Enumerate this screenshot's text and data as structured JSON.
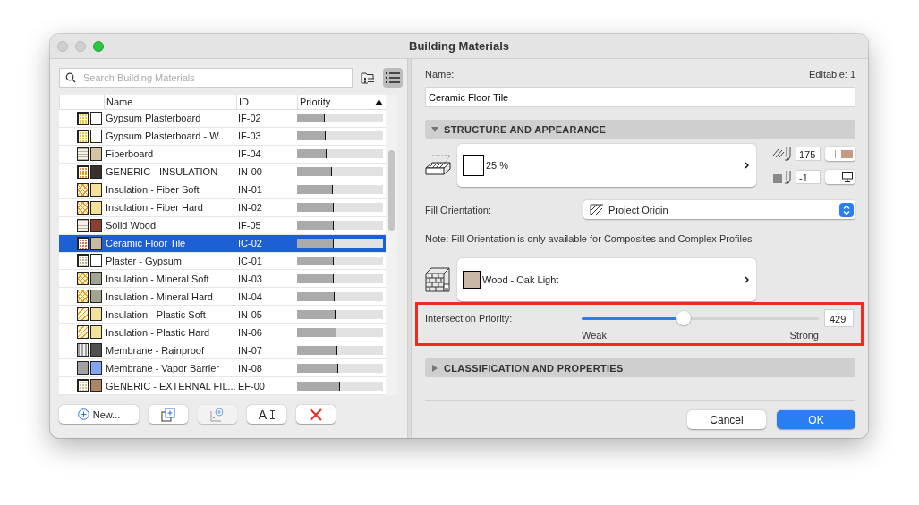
{
  "window": {
    "title": "Building Materials"
  },
  "search": {
    "placeholder": "Search Building Materials"
  },
  "view_toggles": [
    {
      "kind": "tree",
      "selected": false
    },
    {
      "kind": "list",
      "selected": true
    }
  ],
  "table": {
    "columns": [
      "Name",
      "ID",
      "Priority"
    ],
    "sort_ascending": true,
    "rows": [
      {
        "name": "Gypsum Plasterboard",
        "id": "IF-02",
        "level": 0.32,
        "swatches": [
          {
            "kind": "dots",
            "color": "#f0c840"
          },
          {
            "kind": "solid",
            "color": "#ffffff"
          }
        ],
        "selected": false
      },
      {
        "name": "Gypsum Plasterboard - W...",
        "id": "IF-03",
        "level": 0.33,
        "swatches": [
          {
            "kind": "dots",
            "color": "#f0c840"
          },
          {
            "kind": "solid",
            "color": "#ffffff"
          }
        ],
        "selected": false
      },
      {
        "name": "Fiberboard",
        "id": "IF-04",
        "level": 0.34,
        "swatches": [
          {
            "kind": "lines",
            "color": "#b8b0a0"
          },
          {
            "kind": "solid",
            "color": "#d4c4a4"
          }
        ],
        "selected": false
      },
      {
        "name": "GENERIC - INSULATION",
        "id": "IN-00",
        "level": 0.41,
        "swatches": [
          {
            "kind": "dots",
            "color": "#e89a30"
          },
          {
            "kind": "solid",
            "color": "#3a302c"
          }
        ],
        "selected": false
      },
      {
        "name": "Insulation - Fiber Soft",
        "id": "IN-01",
        "level": 0.42,
        "swatches": [
          {
            "kind": "cross",
            "color": "#e89a30"
          },
          {
            "kind": "solid",
            "color": "#f5e29a"
          }
        ],
        "selected": false
      },
      {
        "name": "Insulation - Fiber Hard",
        "id": "IN-02",
        "level": 0.43,
        "swatches": [
          {
            "kind": "cross",
            "color": "#e89a30"
          },
          {
            "kind": "solid",
            "color": "#f5e29a"
          }
        ],
        "selected": false
      },
      {
        "name": "Solid Wood",
        "id": "IF-05",
        "level": 0.43,
        "swatches": [
          {
            "kind": "lines",
            "color": "#b8b0a0"
          },
          {
            "kind": "solid",
            "color": "#8b3f31"
          }
        ],
        "selected": false
      },
      {
        "name": "Ceramic Floor Tile",
        "id": "IC-02",
        "level": 0.43,
        "swatches": [
          {
            "kind": "dots",
            "color": "#d07060"
          },
          {
            "kind": "solid",
            "color": "#c9b8a2"
          }
        ],
        "selected": true
      },
      {
        "name": "Plaster - Gypsum",
        "id": "IC-01",
        "level": 0.43,
        "swatches": [
          {
            "kind": "dots",
            "color": "#b0b0b0"
          },
          {
            "kind": "solid",
            "color": "#ffffff"
          }
        ],
        "selected": false
      },
      {
        "name": "Insulation - Mineral Soft",
        "id": "IN-03",
        "level": 0.43,
        "swatches": [
          {
            "kind": "cross",
            "color": "#e8a020"
          },
          {
            "kind": "solid",
            "color": "#a3a390"
          }
        ],
        "selected": false
      },
      {
        "name": "Insulation - Mineral Hard",
        "id": "IN-04",
        "level": 0.44,
        "swatches": [
          {
            "kind": "cross",
            "color": "#e8a020"
          },
          {
            "kind": "solid",
            "color": "#a3a390"
          }
        ],
        "selected": false
      },
      {
        "name": "Insulation - Plastic Soft",
        "id": "IN-05",
        "level": 0.45,
        "swatches": [
          {
            "kind": "diagonal",
            "color": "#e8a020"
          },
          {
            "kind": "solid",
            "color": "#f5e29a"
          }
        ],
        "selected": false
      },
      {
        "name": "Insulation - Plastic Hard",
        "id": "IN-06",
        "level": 0.46,
        "swatches": [
          {
            "kind": "diagonal",
            "color": "#e8a020"
          },
          {
            "kind": "solid",
            "color": "#f5e29a"
          }
        ],
        "selected": false
      },
      {
        "name": "Membrane - Rainproof",
        "id": "IN-07",
        "level": 0.47,
        "swatches": [
          {
            "kind": "stripes",
            "color": "#a0a0a0"
          },
          {
            "kind": "solid",
            "color": "#505050"
          }
        ],
        "selected": false
      },
      {
        "name": "Membrane - Vapor Barrier",
        "id": "IN-08",
        "level": 0.48,
        "swatches": [
          {
            "kind": "solid",
            "color": "#a0a0a0"
          },
          {
            "kind": "solid",
            "color": "#7fa7f5"
          }
        ],
        "selected": false
      },
      {
        "name": "GENERIC - EXTERNAL FIL...",
        "id": "EF-00",
        "level": 0.5,
        "swatches": [
          {
            "kind": "dots",
            "color": "#c8c0b0"
          },
          {
            "kind": "solid",
            "color": "#ae8464"
          }
        ],
        "selected": false
      }
    ]
  },
  "list_buttons": [
    {
      "kind": "new",
      "label": "New...",
      "disabled": false
    },
    {
      "kind": "duplicate",
      "disabled": false
    },
    {
      "kind": "new-folder",
      "disabled": true
    },
    {
      "kind": "rename",
      "label": "A",
      "disabled": false
    },
    {
      "kind": "delete",
      "disabled": false
    }
  ],
  "details": {
    "name_label": "Name:",
    "editable": "Editable: 1",
    "name_value": "Ceramic Floor Tile",
    "structure": {
      "title": "STRUCTURE AND APPEARANCE",
      "expanded": true,
      "cut_fill": "25 %",
      "pens": [
        {
          "value": "175",
          "color": "#c49a85"
        },
        {
          "value": "-1"
        }
      ],
      "fill_orientation_label": "Fill Orientation:",
      "fill_orientation": "Project Origin",
      "note": "Note: Fill Orientation is only available for Composites and Complex Profiles",
      "surface": {
        "name": "Wood - Oak Light",
        "color": "#c8b8a4"
      }
    },
    "priority": {
      "label": "Intersection Priority:",
      "level": 0.43,
      "value": "429",
      "min_label": "Weak",
      "max_label": "Strong",
      "highlighted": true
    },
    "classification": {
      "title": "CLASSIFICATION AND PROPERTIES",
      "expanded": false
    }
  },
  "buttons": [
    {
      "label": "Cancel",
      "primary": false
    },
    {
      "label": "OK",
      "primary": true
    }
  ]
}
